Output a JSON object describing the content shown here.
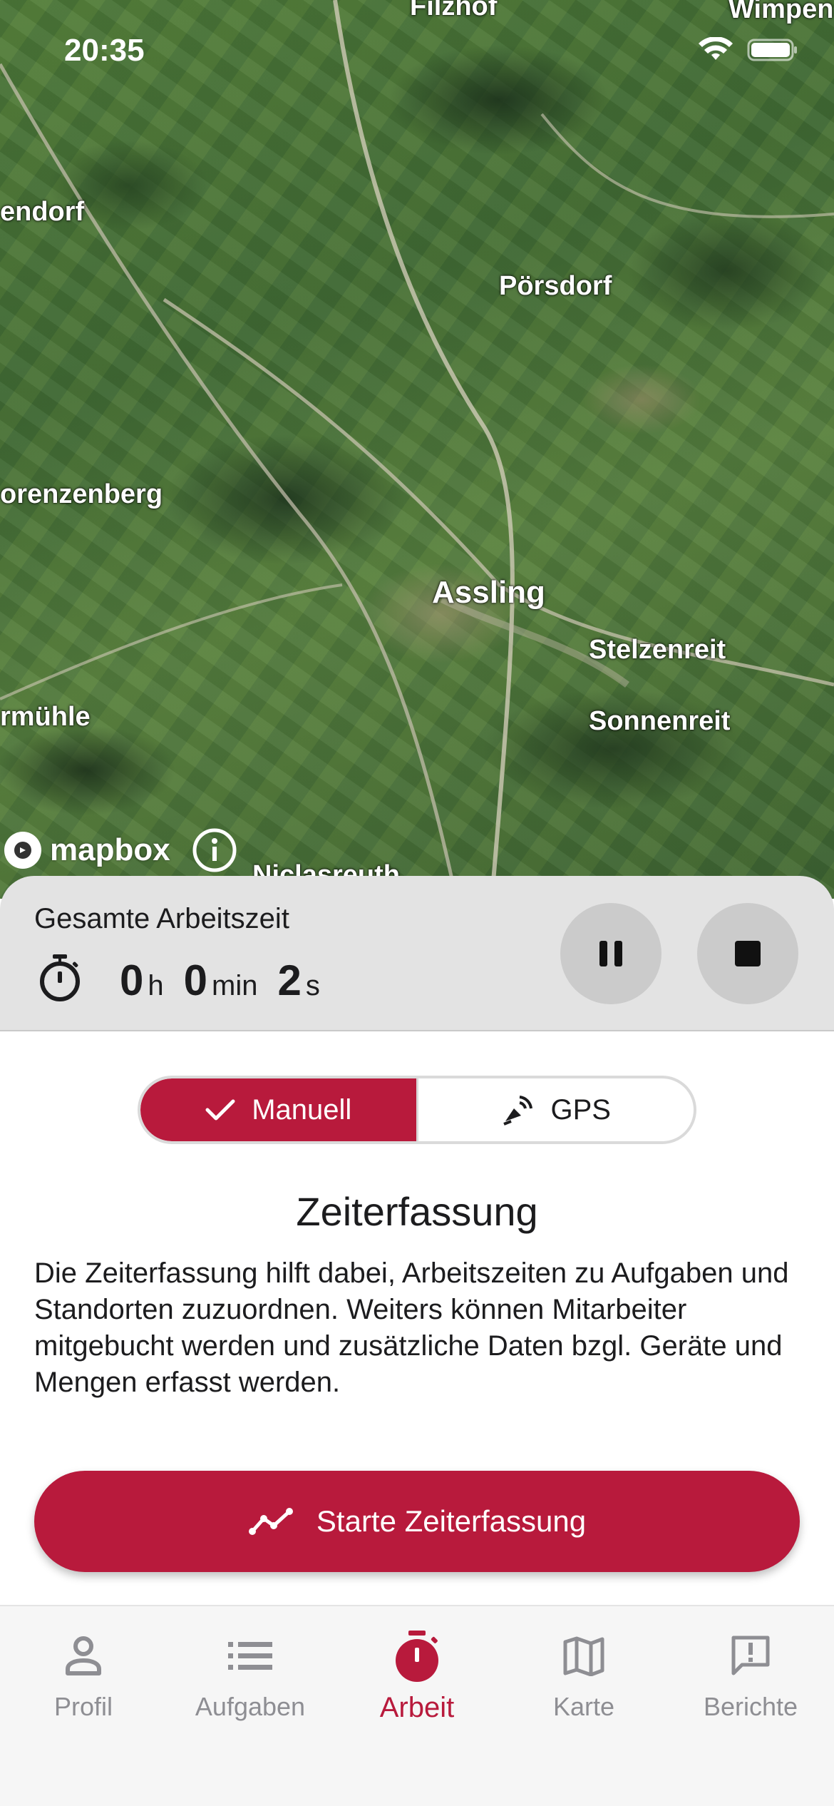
{
  "status_bar": {
    "time": "20:35"
  },
  "map": {
    "labels": {
      "filzhof": "Filzhof",
      "wimpen": "Wimpen",
      "endorf": "endorf",
      "poersdorf": "Pörsdorf",
      "orenzenberg": "orenzenberg",
      "assling": "Assling",
      "stelzenreit": "Stelzenreit",
      "sonnenreit": "Sonnenreit",
      "rmuehle": "rmühle",
      "niclasreuth": "Niclasreuth"
    },
    "attribution": "mapbox"
  },
  "timer": {
    "title": "Gesamte Arbeitszeit",
    "hours": "0",
    "hours_unit": "h",
    "minutes": "0",
    "minutes_unit": "min",
    "seconds": "2",
    "seconds_unit": "s"
  },
  "mode_toggle": {
    "manual_label": "Manuell",
    "gps_label": "GPS",
    "selected": "Manuell"
  },
  "content": {
    "title": "Zeiterfassung",
    "description": "Die Zeiterfassung hilft dabei, Arbeitszeiten zu Aufgaben und Standorten zuzuordnen. Weiters können Mitarbeiter mitgebucht werden und zusätzliche Daten bzgl. Geräte und Mengen erfasst werden.",
    "start_button": "Starte Zeiterfassung"
  },
  "bottom_nav": {
    "items": [
      {
        "label": "Profil",
        "icon": "person-icon"
      },
      {
        "label": "Aufgaben",
        "icon": "list-icon"
      },
      {
        "label": "Arbeit",
        "icon": "stopwatch-icon"
      },
      {
        "label": "Karte",
        "icon": "map-icon"
      },
      {
        "label": "Berichte",
        "icon": "report-icon"
      }
    ],
    "active": "Arbeit"
  },
  "colors": {
    "accent": "#b81a3c",
    "inactive_text": "#8e8e93",
    "panel_bg": "#e3e3e3"
  }
}
